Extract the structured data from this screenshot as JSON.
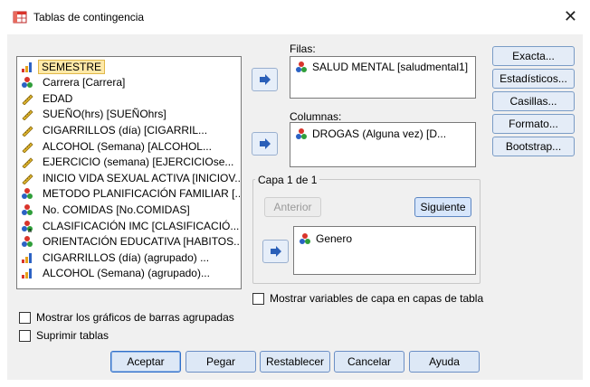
{
  "window": {
    "title": "Tablas de contingencia",
    "close_glyph": "✕"
  },
  "variables": [
    {
      "label": "SEMESTRE",
      "icon": "ordinal-icon",
      "selected": true
    },
    {
      "label": "Carrera  [Carrera]",
      "icon": "nominal-icon"
    },
    {
      "label": "EDAD",
      "icon": "scale-icon"
    },
    {
      "label": "SUEÑO(hrs) [SUEÑOhrs]",
      "icon": "scale-icon"
    },
    {
      "label": "CIGARRILLOS         (día) [CIGARRIL...",
      "icon": "scale-icon"
    },
    {
      "label": "ALCOHOL        (Semana) [ALCOHOL...",
      "icon": "scale-icon"
    },
    {
      "label": "EJERCICIO (semana) [EJERCICIOse...",
      "icon": "scale-icon"
    },
    {
      "label": "INICIO VIDA SEXUAL ACTIVA  [INICIOV...",
      "icon": "scale-icon"
    },
    {
      "label": "METODO PLANIFICACIÓN FAMILIAR  [...",
      "icon": "nominal-icon"
    },
    {
      "label": "No. COMIDAS [No.COMIDAS]",
      "icon": "nominal-icon"
    },
    {
      "label": "CLASIFICACIÓN   IMC [CLASIFICACIÓ...",
      "icon": "nominal-string-icon"
    },
    {
      "label": "ORIENTACIÓN EDUCATIVA [HABITOS...",
      "icon": "nominal-icon"
    },
    {
      "label": "CIGARRILLOS         (día) (agrupado) ...",
      "icon": "ordinal-icon"
    },
    {
      "label": "ALCOHOL        (Semana) (agrupado)...",
      "icon": "ordinal-icon"
    }
  ],
  "rows": {
    "label": "Filas:",
    "items": [
      {
        "label": "SALUD MENTAL [saludmental1]",
        "icon": "nominal-icon"
      }
    ]
  },
  "columns": {
    "label": "Columnas:",
    "items": [
      {
        "label": "DROGAS           (Alguna vez) [D...",
        "icon": "nominal-icon"
      }
    ]
  },
  "layer": {
    "title": "Capa 1 de 1",
    "prev_label": "Anterior",
    "next_label": "Siguiente",
    "items": [
      {
        "label": "Genero",
        "icon": "nominal-icon"
      }
    ]
  },
  "side_buttons": {
    "exact": "Exacta...",
    "statistics": "Estadísticos...",
    "cells": "Casillas...",
    "format": "Formato...",
    "bootstrap": "Bootstrap..."
  },
  "options": {
    "layer_vars": "Mostrar variables de capa en capas de tabla",
    "clustered_bars": "Mostrar los gráficos de barras agrupadas",
    "suppress_tables": "Suprimir tablas"
  },
  "footer": {
    "ok": "Aceptar",
    "paste": "Pegar",
    "reset": "Restablecer",
    "cancel": "Cancelar",
    "help": "Ayuda"
  },
  "colors": {
    "selection": "#ffe9a8",
    "nominal_red": "#d9342b",
    "nominal_blue": "#2b62c4",
    "nominal_green": "#2f9e3a",
    "scale_yellow": "#e0b62d",
    "arrow_blue": "#2a5fb8"
  }
}
